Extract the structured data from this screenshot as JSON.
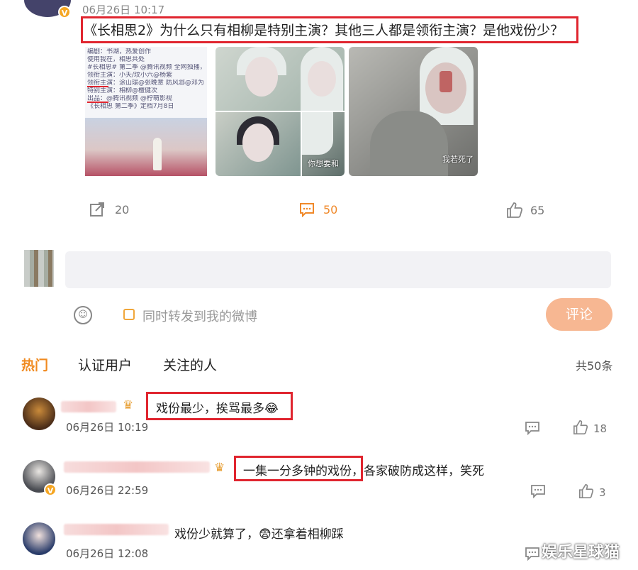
{
  "post": {
    "time": "06月26日 10:17",
    "text": "《长相思2》为什么只有相柳是特别主演？其他三人都是领衔主演？是他戏份少？",
    "image1_lines": [
      "编剧：书湖，热爱创作",
      "使用我在，相思共处",
      "#长相思# 第二季 @腾讯视频 全网独播，敬请期待",
      "领衔主演：小夭/玟小六@杨紫",
      "领衔主演：涂山璟@张晚意 防风邶@邓为 赤水丰隆@王弘毅",
      "特别主演：相柳@檀健次",
      "出品：@腾讯视频 @柠萌影视",
      "《长相思 第二季》定档7月8日"
    ],
    "image2_caption": "你想要和",
    "image3_caption": "我若死了",
    "actions": {
      "share_count": "20",
      "comment_count": "50",
      "like_count": "65"
    }
  },
  "composer": {
    "repost_label": "同时转发到我的微博",
    "submit_label": "评论"
  },
  "tabs": {
    "hot": "热门",
    "verified": "认证用户",
    "following": "关注的人",
    "total": "共50条"
  },
  "comments": [
    {
      "text": "戏份最少，挨骂最多",
      "emoji": "😂",
      "time": "06月26日 10:19",
      "likes": "18"
    },
    {
      "text_boxed": "一集一分多钟的戏份，",
      "text_rest": "各家破防成这样，笑死",
      "time": "06月26日 22:59",
      "likes": "3"
    },
    {
      "text_a": "戏份少就算了，",
      "emoji": "😨",
      "text_b": "还拿着相柳踩",
      "time": "06月26日 12:08"
    }
  ],
  "watermark": "娱乐星球猫",
  "colors": {
    "accent": "#f08a20",
    "highlight": "#e0252f",
    "submit": "#f7b792"
  }
}
